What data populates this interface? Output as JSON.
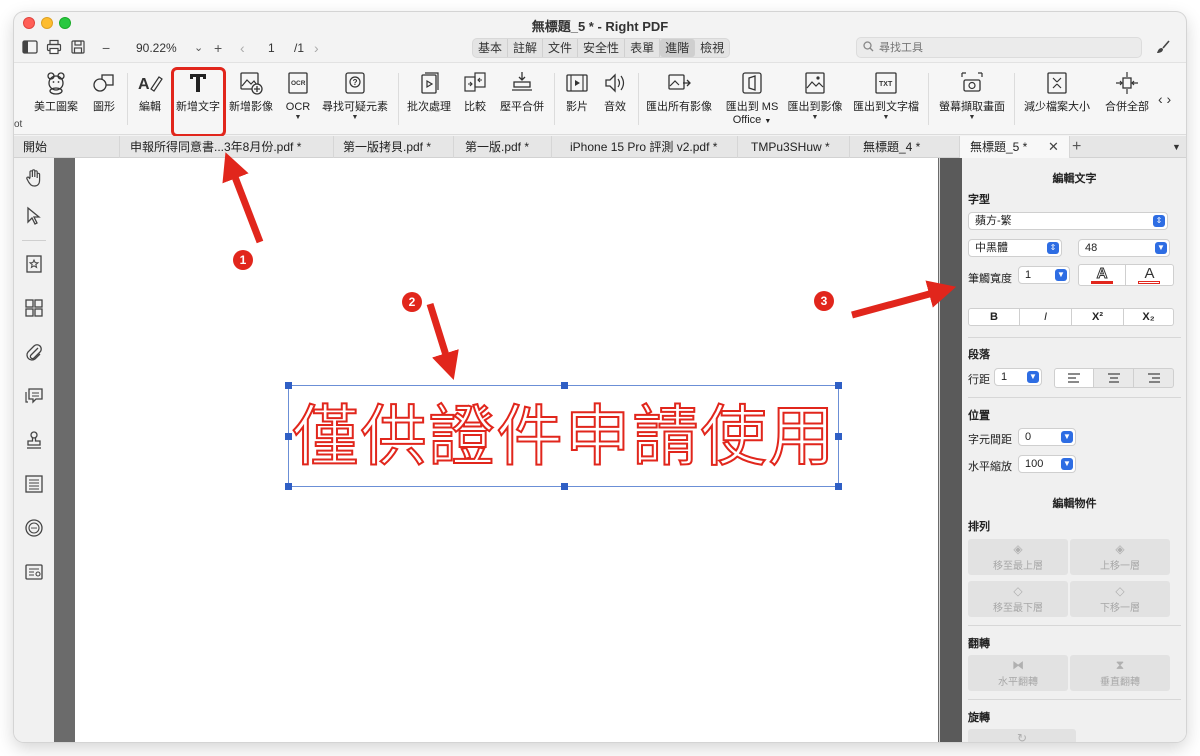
{
  "window": {
    "title": "無標題_5 * - Right PDF"
  },
  "toolbar": {
    "zoom": "90.22%",
    "zoom_minus": "−",
    "zoom_plus": "+",
    "page_current": "1",
    "page_total": "/1",
    "mode_tabs": [
      "基本",
      "註解",
      "文件",
      "安全性",
      "表單",
      "進階",
      "檢視"
    ],
    "active_mode": "進階",
    "search_placeholder": "尋找工具"
  },
  "ribbon": {
    "left_clip": "ot",
    "buttons": [
      {
        "label": "美工圖案"
      },
      {
        "label": "圖形"
      },
      {
        "label": "編輯"
      },
      {
        "label": "新增文字"
      },
      {
        "label": "新增影像"
      },
      {
        "label": "OCR"
      },
      {
        "label": "尋找可疑元素"
      },
      {
        "label": "批次處理"
      },
      {
        "label": "比較"
      },
      {
        "label": "壓平合併"
      },
      {
        "label": "影片"
      },
      {
        "label": "音效"
      },
      {
        "label": "匯出所有影像"
      },
      {
        "label": "匯出到 MS",
        "label2": "Office"
      },
      {
        "label": "匯出到影像"
      },
      {
        "label": "匯出到文字檔"
      },
      {
        "label": "螢幕擷取畫面"
      },
      {
        "label": "減少檔案大小"
      },
      {
        "label": "合併全部"
      }
    ],
    "highlighted": "新增文字"
  },
  "doc_tabs": [
    "開始",
    "申報所得同意書...3年8月份.pdf *",
    "第一版拷貝.pdf *",
    "第一版.pdf *",
    "iPhone 15 Pro 評測 v2.pdf *",
    "TMPu3SHuw *",
    "無標題_4 *",
    "無標題_5 *"
  ],
  "active_doc": "無標題_5 *",
  "document": {
    "text": "僅供證件申請使用",
    "text_color": "#e1261c"
  },
  "panel": {
    "title": "編輯文字",
    "font_section": "字型",
    "font_family": "蘋方-繁",
    "font_weight": "中黑體",
    "font_size": "48",
    "stroke_label": "筆觸寬度",
    "stroke_value": "1",
    "color_a1": "A",
    "color_a2": "A",
    "bold": "B",
    "italic": "I",
    "superscript": "X²",
    "subscript": "X₂",
    "paragraph_section": "段落",
    "line_spacing_label": "行距",
    "line_spacing_value": "1",
    "position_section": "位置",
    "char_spacing_label": "字元間距",
    "char_spacing_value": "0",
    "hscale_label": "水平縮放",
    "hscale_value": "100",
    "edit_object_title": "編輯物件",
    "arrange_section": "排列",
    "bring_front": "移至最上層",
    "bring_forward": "上移一層",
    "send_back": "移至最下層",
    "send_backward": "下移一層",
    "flip_section": "翻轉",
    "flip_h": "水平翻轉",
    "flip_v": "垂直翻轉",
    "rotate_section": "旋轉"
  },
  "annotations": {
    "badges": [
      "1",
      "2",
      "3"
    ],
    "color": "#e1261c"
  }
}
